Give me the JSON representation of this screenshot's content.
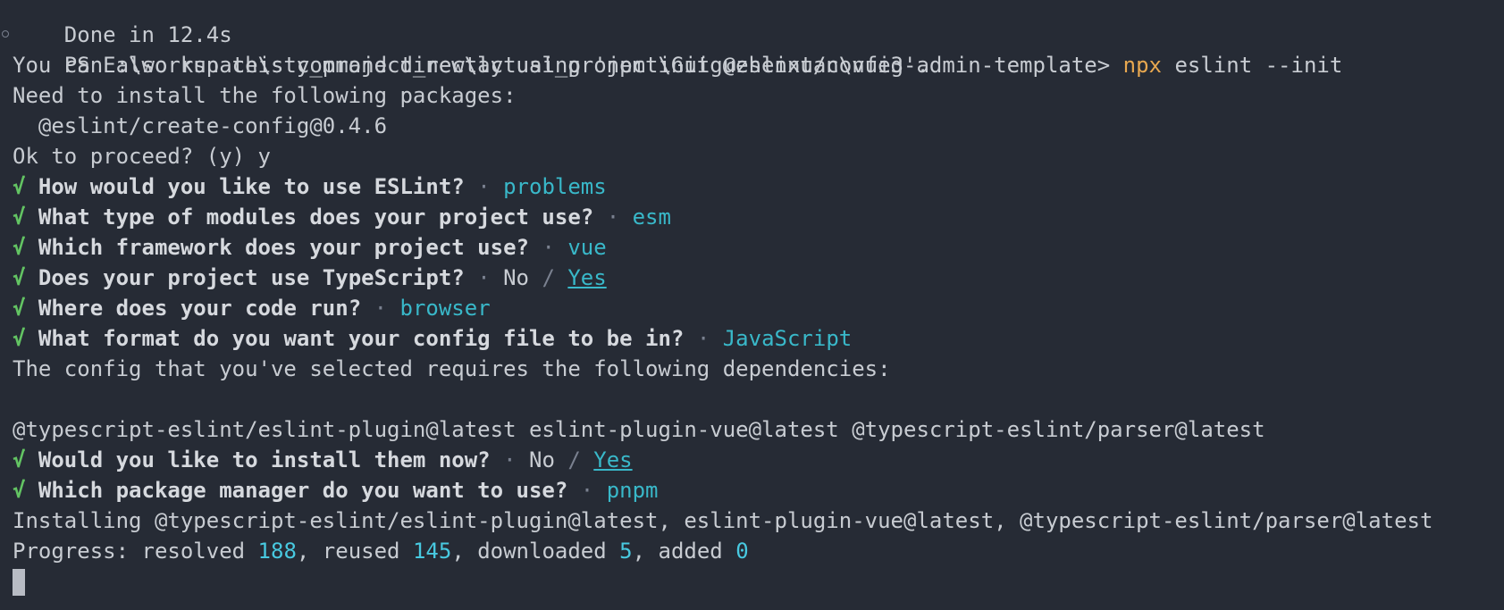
{
  "terminal": {
    "done_line": "Done in 12.4s",
    "prompt": "PS E:\\workspace\\sty_project_new\\actual_project\\Guiguzhenxuan\\vue3-admin-template>",
    "command_bin": "npx",
    "command_args": "eslint --init",
    "info1": "You can also run this command directly using 'npm init @eslint/config'.",
    "info2": "Need to install the following packages:",
    "package": "  @eslint/create-config@0.4.6",
    "proceed": "Ok to proceed? (y) y",
    "check": "√",
    "dot": "·",
    "slash": "/",
    "questions": [
      {
        "q": "How would you like to use ESLint?",
        "a": "problems"
      },
      {
        "q": "What type of modules does your project use?",
        "a": "esm"
      },
      {
        "q": "Which framework does your project use?",
        "a": "vue"
      },
      {
        "q": "Does your project use TypeScript?",
        "no": "No",
        "yes": "Yes"
      },
      {
        "q": "Where does your code run?",
        "a": "browser"
      },
      {
        "q": "What format do you want your config file to be in?",
        "a": "JavaScript"
      }
    ],
    "deps_msg": "The config that you've selected requires the following dependencies:",
    "deps_list": "@typescript-eslint/eslint-plugin@latest eslint-plugin-vue@latest @typescript-eslint/parser@latest",
    "install_q": {
      "q": "Would you like to install them now?",
      "no": "No",
      "yes": "Yes"
    },
    "pm_q": {
      "q": "Which package manager do you want to use?",
      "a": "pnpm"
    },
    "installing": "Installing @typescript-eslint/eslint-plugin@latest, eslint-plugin-vue@latest, @typescript-eslint/parser@latest",
    "progress": {
      "label": "Progress: resolved ",
      "resolved": "188",
      "reused_label": ", reused ",
      "reused": "145",
      "downloaded_label": ", downloaded ",
      "downloaded": "5",
      "added_label": ", added ",
      "added": "0"
    }
  }
}
